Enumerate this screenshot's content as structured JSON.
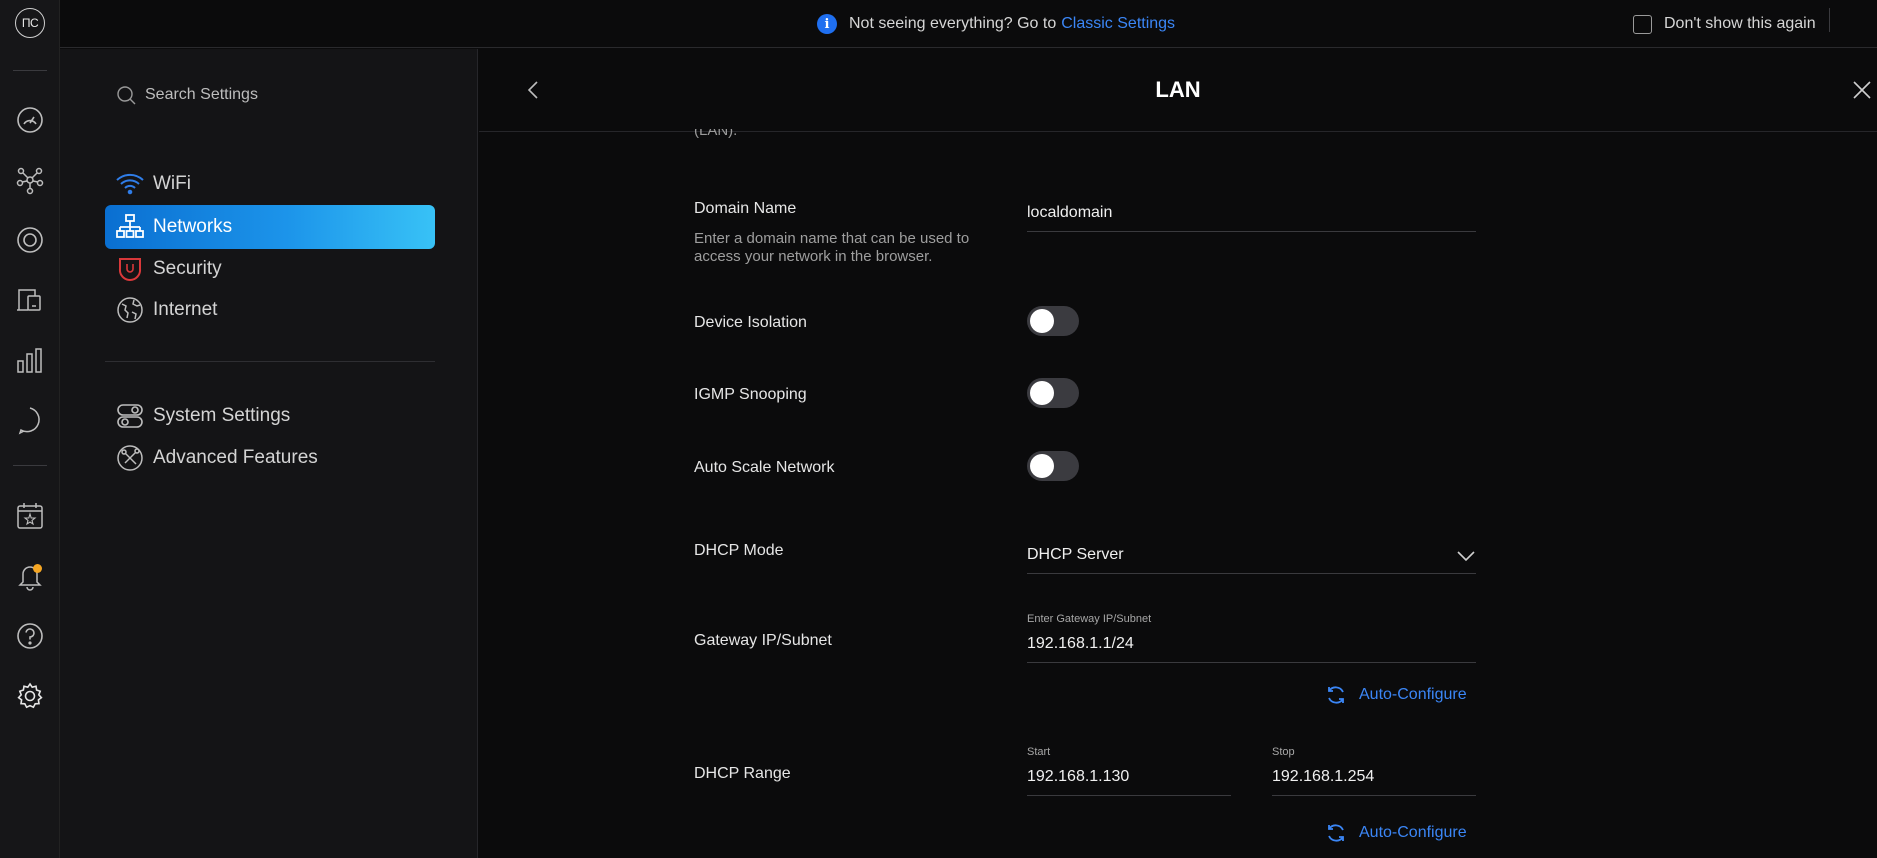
{
  "rail": {
    "logo_text": "ΠC",
    "icons": [
      "dashboard-icon",
      "topology-icon",
      "devices-icon",
      "clients-icon",
      "statistics-icon",
      "insights-icon",
      "events-icon",
      "alerts-icon",
      "help-icon",
      "settings-icon"
    ],
    "notification_color": "#f5a623"
  },
  "topbar": {
    "notice_text": "Not seeing everything? Go to",
    "notice_link": "Classic Settings",
    "dont_show_label": "Don't show this again",
    "accent": "#3b86f6"
  },
  "sidebar": {
    "search_placeholder": "Search Settings",
    "items": [
      {
        "label": "WiFi",
        "icon": "wifi-icon",
        "active": false
      },
      {
        "label": "Networks",
        "icon": "networks-icon",
        "active": true
      },
      {
        "label": "Security",
        "icon": "shield-icon",
        "active": false
      },
      {
        "label": "Internet",
        "icon": "globe-icon",
        "active": false
      }
    ],
    "items2": [
      {
        "label": "System Settings",
        "icon": "toggles-icon"
      },
      {
        "label": "Advanced Features",
        "icon": "tools-icon"
      }
    ]
  },
  "main": {
    "title": "LAN",
    "cutoff_text": "(LAN).",
    "domain": {
      "label": "Domain Name",
      "description": "Enter a domain name that can be used to access your network in the browser.",
      "value": "localdomain"
    },
    "device_isolation": {
      "label": "Device Isolation",
      "on": false
    },
    "igmp": {
      "label": "IGMP Snooping",
      "on": false
    },
    "autoscale": {
      "label": "Auto Scale Network",
      "on": false
    },
    "dhcp_mode": {
      "label": "DHCP Mode",
      "value": "DHCP Server"
    },
    "gateway": {
      "label": "Gateway IP/Subnet",
      "caption": "Enter Gateway IP/Subnet",
      "value": "192.168.1.1/24",
      "auto_label": "Auto-Configure"
    },
    "range": {
      "label": "DHCP Range",
      "start_caption": "Start",
      "start_value": "192.168.1.130",
      "stop_caption": "Stop",
      "stop_value": "192.168.1.254",
      "auto_label": "Auto-Configure"
    }
  }
}
